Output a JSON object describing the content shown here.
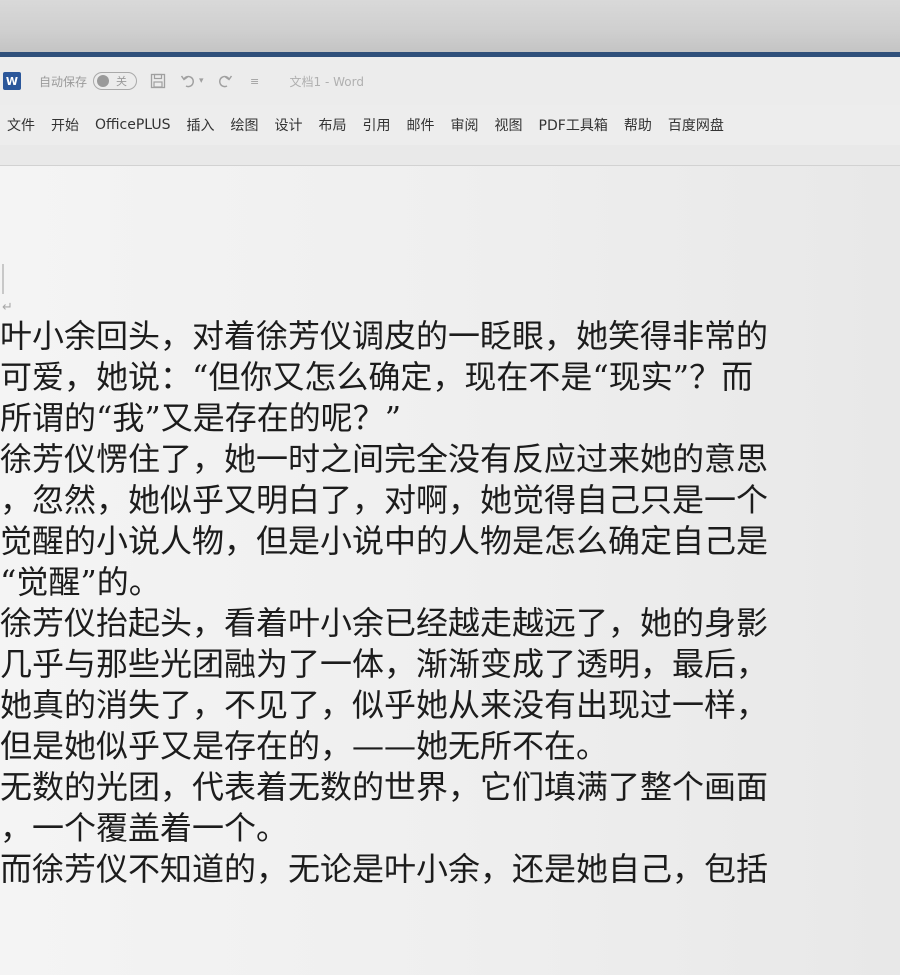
{
  "titlebar": {
    "autosave_label": "自动保存",
    "autosave_state": "关",
    "doc_title": "文档1 - Word"
  },
  "menu": [
    "文件",
    "开始",
    "OfficePLUS",
    "插入",
    "绘图",
    "设计",
    "布局",
    "引用",
    "邮件",
    "审阅",
    "视图",
    "PDF工具箱",
    "帮助",
    "百度网盘"
  ],
  "document": {
    "lines": [
      "叶小余回头，对着徐芳仪调皮的一眨眼，她笑得非常的",
      "可爱，她说：“但你又怎么确定，现在不是“现实”？而",
      "所谓的“我”又是存在的呢？”",
      "徐芳仪愣住了，她一时之间完全没有反应过来她的意思",
      "，忽然，她似乎又明白了，对啊，她觉得自己只是一个",
      "觉醒的小说人物，但是小说中的人物是怎么确定自己是",
      "“觉醒”的。",
      "徐芳仪抬起头，看着叶小余已经越走越远了，她的身影",
      "几乎与那些光团融为了一体，渐渐变成了透明，最后，",
      "她真的消失了，不见了，似乎她从来没有出现过一样，",
      "但是她似乎又是存在的，——她无所不在。",
      "无数的光团，代表着无数的世界，它们填满了整个画面",
      "，一个覆盖着一个。",
      "而徐芳仪不知道的，无论是叶小余，还是她自己，包括"
    ]
  },
  "colors": {
    "accent": "#2f4f7a",
    "word_blue": "#2b579a"
  }
}
